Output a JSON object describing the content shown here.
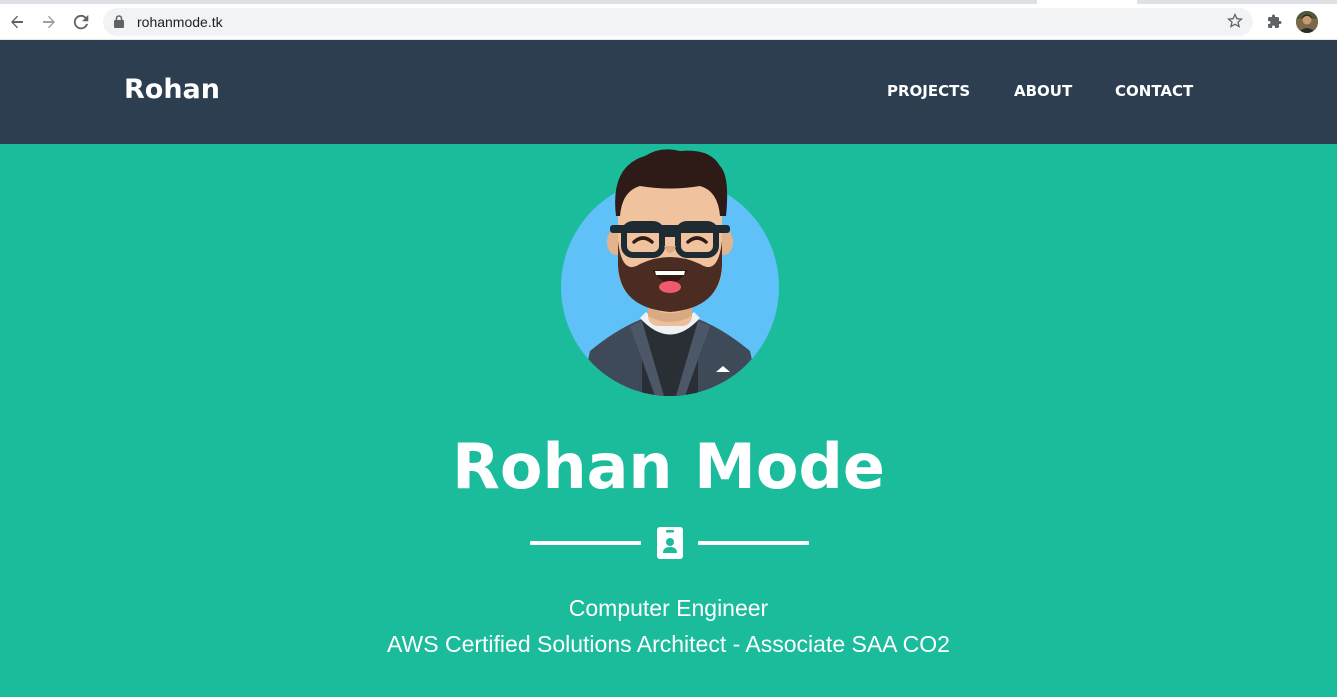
{
  "browser": {
    "url": "rohanmode.tk"
  },
  "navbar": {
    "brand": "Rohan",
    "links": [
      "PROJECTS",
      "ABOUT",
      "CONTACT"
    ]
  },
  "masthead": {
    "title": "Rohan Mode",
    "subtitle_line1": "Computer Engineer",
    "subtitle_line2": "AWS Certified Solutions Architect - Associate SAA CO2"
  },
  "colors": {
    "masthead_bg": "#1abc9c",
    "navbar_bg": "#2c3e50",
    "text": "#ffffff"
  },
  "icons": [
    "back-arrow-icon",
    "forward-arrow-icon",
    "reload-icon",
    "lock-icon",
    "bookmark-star-icon",
    "extensions-puzzle-icon",
    "profile-avatar",
    "id-badge-icon"
  ]
}
